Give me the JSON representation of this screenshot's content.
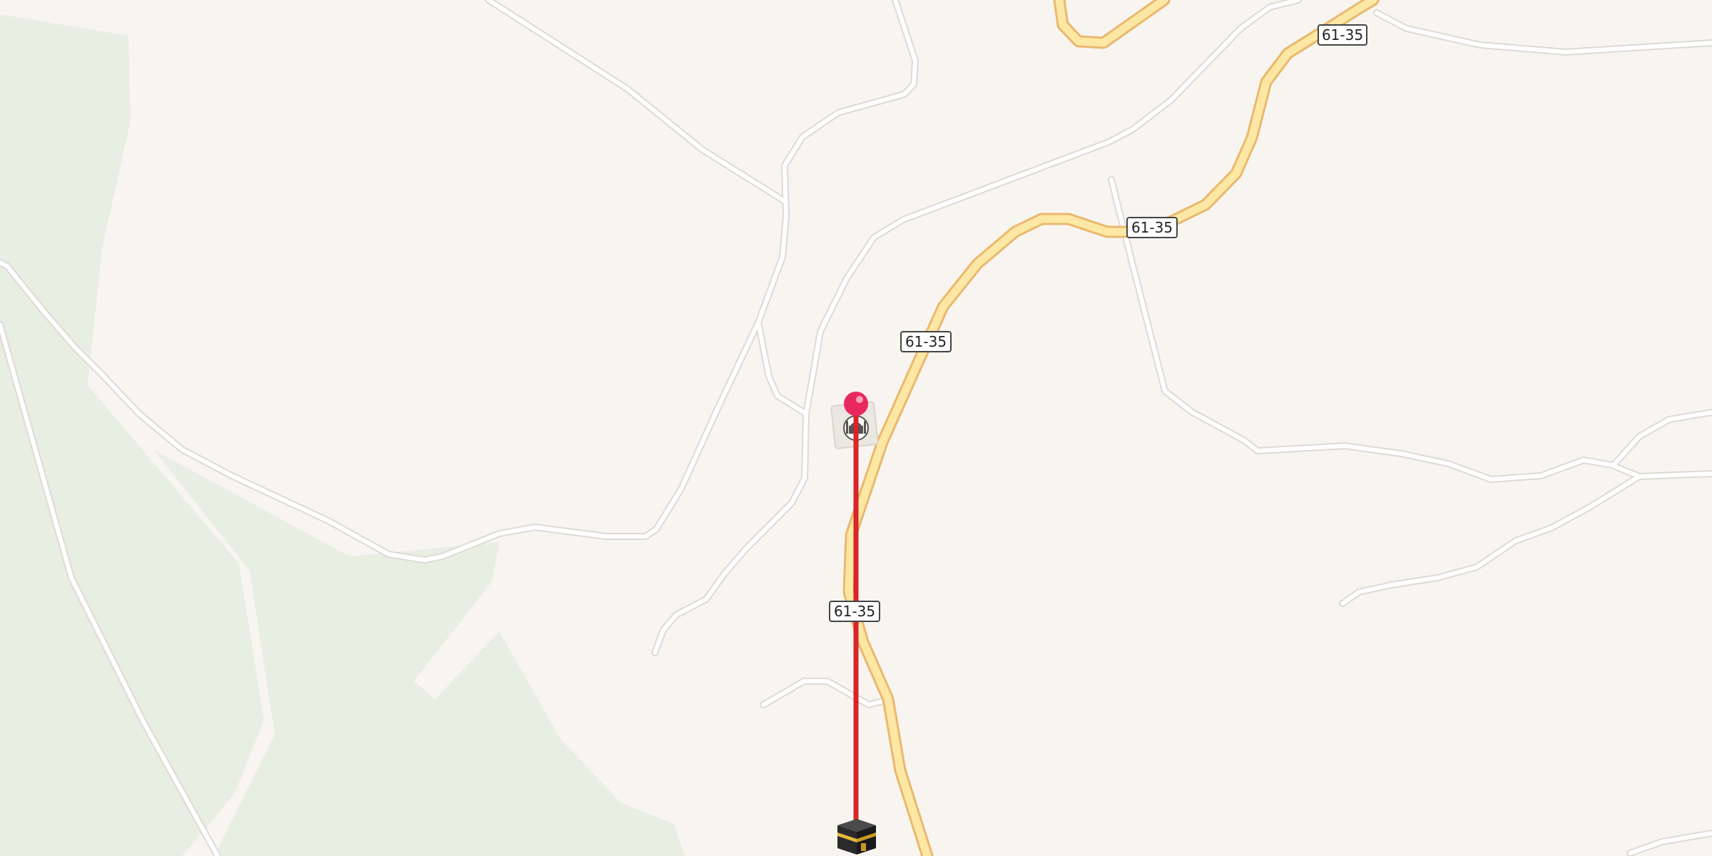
{
  "map": {
    "road_shields": [
      {
        "label": "61-35"
      },
      {
        "label": "61-35"
      },
      {
        "label": "61-35"
      },
      {
        "label": "61-35"
      }
    ],
    "markers": {
      "origin": {
        "icon": "pin-icon"
      },
      "place": {
        "icon": "mosque-icon"
      },
      "destination": {
        "icon": "kaaba-icon"
      }
    },
    "colors": {
      "background": "#f8f5f1",
      "green_area": "#e9eee3",
      "minor_road_fill": "#ffffff",
      "minor_road_casing": "#dddad6",
      "highway_fill": "#fde7a4",
      "highway_casing": "#eab86d",
      "direction_line": "#d92528",
      "pin": "#e8285d"
    }
  }
}
